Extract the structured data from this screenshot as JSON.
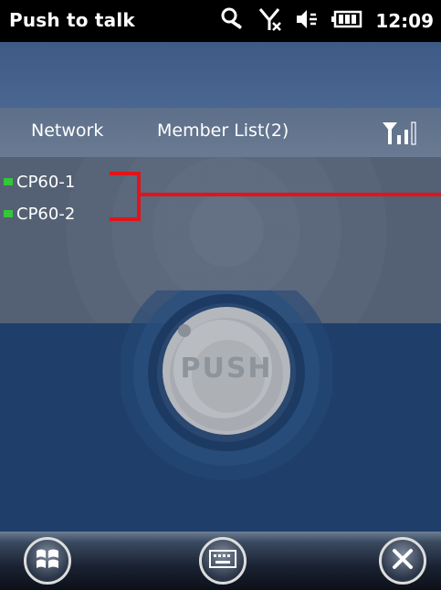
{
  "titlebar": {
    "app_title": "Push to talk",
    "time": "12:09",
    "icons": [
      "sync-icon",
      "no-signal-icon",
      "speaker-muted-icon",
      "battery-icon"
    ]
  },
  "tabs": {
    "network_label": "Network",
    "members_label": "Member List(2)",
    "signal_icon": "signal-strength-icon"
  },
  "members": [
    {
      "name": "CP60-1",
      "status_color": "#35c63a"
    },
    {
      "name": "CP60-2",
      "status_color": "#35c63a"
    }
  ],
  "push_button": {
    "label": "PUSH"
  },
  "annotation": {
    "color": "#e0141b"
  },
  "toolbar": {
    "start_icon": "windows-start-icon",
    "keyboard_icon": "keyboard-icon",
    "close_icon": "close-icon"
  }
}
